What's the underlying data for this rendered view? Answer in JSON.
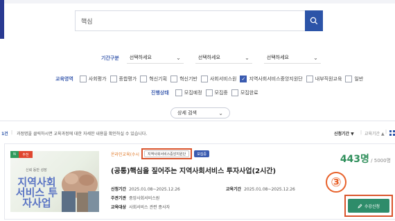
{
  "colors": {
    "brand": "#2c54a8",
    "label_blue": "#3f5fb0",
    "enroll_green": "#2f8f5b",
    "highlight_red": "#d9532b",
    "callout_orange": "#e8612a",
    "apply_green": "#2e8c6a"
  },
  "search": {
    "value": "핵심",
    "icon": "search-icon"
  },
  "period": {
    "label": "기간구분",
    "selects": [
      "선택하세요",
      "선택하세요",
      "선택하세요"
    ]
  },
  "education_area": {
    "label": "교육영역",
    "options": [
      {
        "label": "사회평가",
        "checked": false
      },
      {
        "label": "종합평가",
        "checked": false
      },
      {
        "label": "혁신기획",
        "checked": false
      },
      {
        "label": "혁신기반",
        "checked": false
      },
      {
        "label": "사회서비스원",
        "checked": false
      },
      {
        "label": "지역사회서비스중앙지원단",
        "checked": true
      },
      {
        "label": "내부직원교육",
        "checked": false
      },
      {
        "label": "일반",
        "checked": false
      }
    ]
  },
  "progress_status": {
    "label": "진행상태",
    "options": [
      {
        "label": "모집예정",
        "checked": false
      },
      {
        "label": "모집중",
        "checked": false
      },
      {
        "label": "모집완료",
        "checked": false
      }
    ]
  },
  "detail_search_label": "상세 검색",
  "results": {
    "count": "1건",
    "notice": "과정명을 클릭하시면 교육과정에 대한 자세한 내용을 확인하실 수 있습니다.",
    "sort_options": [
      "신청기간 ▼",
      "교육기간 ▲"
    ],
    "view_icon": "grid-view-icon"
  },
  "course": {
    "thumb_new": "N",
    "thumb_recommend": "추천",
    "thumb_title": "지역사회 서비스 투자사업",
    "thumb_subtitle": "신뢰 동반 성장",
    "category": "온라인교육(수시",
    "area_tag": "지역사회서비스중앙지원단",
    "status_tag": "모집중",
    "title": "(공통)핵심을 짚어주는 지역사회서비스 투자사업(2시간)",
    "apply_period_label": "신청기간",
    "apply_period": "2025.01.08~2025.12.26",
    "edu_period_label": "교육기간",
    "edu_period": "2025.01.08~2025.12.26",
    "organizer_label": "주관기관",
    "organizer": "중앙사회서비스원",
    "target_label": "교육대상",
    "target": "사회서비스 관련 종사자",
    "enrolled": "443명",
    "capacity": "/ 5000명",
    "callout": "③",
    "apply_label": "수강신청",
    "apply_icon": "pencil-icon"
  }
}
